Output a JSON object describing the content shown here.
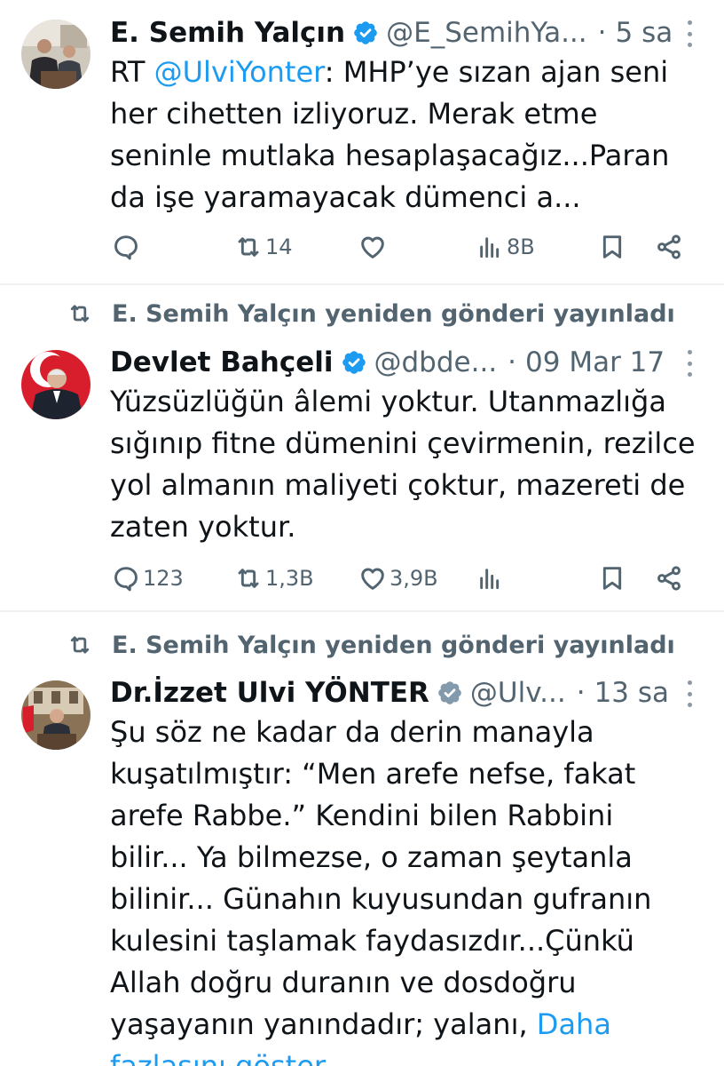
{
  "tweets": [
    {
      "author_name": "E. Semih Yalçın",
      "handle": "@E_SemihYa...",
      "dot": "·",
      "time": "5 sa",
      "text_prefix": "RT ",
      "mention": "@UlviYonter",
      "text": ": MHP’ye sızan ajan seni her cihetten izliyoruz. Merak etme seninle mutlaka hesaplaşacağız...Paran da işe yaramayacak dümenci a...",
      "actions": {
        "reply": "",
        "retweet": "14",
        "like": "",
        "views": "8B"
      }
    },
    {
      "retweet_line": "E. Semih Yalçın yeniden gönderi yayınladı",
      "author_name": "Devlet Bahçeli",
      "handle": "@dbde...",
      "dot": "·",
      "time": "09 Mar 17",
      "text": "Yüzsüzlüğün âlemi yoktur. Utanmazlığa sığınıp fitne dümenini çevirmenin, rezilce yol almanın maliyeti çoktur, mazereti de zaten yoktur.",
      "actions": {
        "reply": "123",
        "retweet": "1,3B",
        "like": "3,9B",
        "views": ""
      }
    },
    {
      "retweet_line": "E. Semih Yalçın yeniden gönderi yayınladı",
      "author_name": "Dr.İzzet Ulvi YÖNTER",
      "handle": "@Ulv...",
      "dot": "·",
      "time": "13 sa",
      "text": "Şu söz ne kadar da derin manayla kuşatılmıştır: “Men arefe nefse, fakat arefe Rabbe.” Kendini bilen Rabbini bilir... Ya bilmezse, o zaman şeytanla bilinir... Günahın kuyusundan gufranın kulesini taşlamak faydasızdır...Çünkü Allah doğru duranın ve dosdoğru yaşayanın yanındadır; yalanı, ",
      "show_more": "Daha fazlasını göster"
    }
  ],
  "colors": {
    "accent": "#1d9bf0",
    "secondary_text": "#536471",
    "divider": "#eff3f4",
    "verified_blue": "#1d9bf0",
    "verified_gray": "#829aab"
  }
}
